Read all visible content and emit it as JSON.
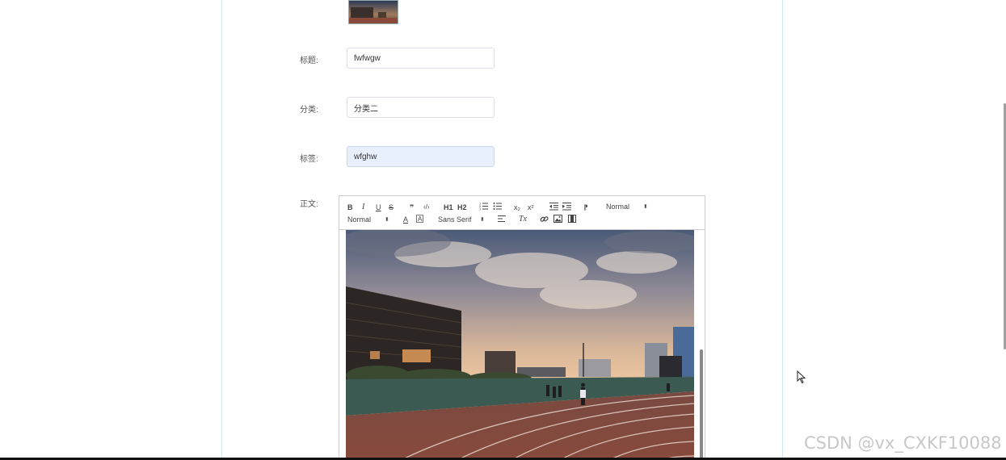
{
  "form": {
    "title": {
      "label": "标题:",
      "value": "fwfwgw"
    },
    "category": {
      "label": "分类:",
      "value": "分类二"
    },
    "tags": {
      "label": "标签:",
      "value": "wfghw"
    },
    "body": {
      "label": "正文:"
    }
  },
  "editor": {
    "toolbar": {
      "bold": "B",
      "italic": "I",
      "underline": "U",
      "strike": "S",
      "blockquote": "❞",
      "code": "‹/›",
      "h1": "H1",
      "h2": "H2",
      "subscript": "x₂",
      "superscript": "x²",
      "direction": "⁋",
      "header_select": "Normal",
      "size_select": "Normal",
      "font_color": "A",
      "background_color": "A",
      "font_select": "Sans Serif",
      "clean": "Tx"
    }
  },
  "watermark": "CSDN @vx_CXKF10088",
  "colors": {
    "panel_border": "#cfe9f0",
    "focused_input": "#e8f0fe",
    "input_border": "#dcdfe6"
  }
}
